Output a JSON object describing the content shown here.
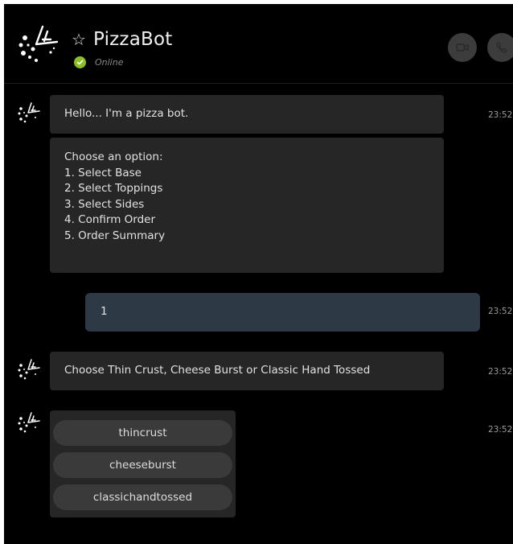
{
  "header": {
    "bot_name": "PizzaBot",
    "status": "Online",
    "favorite_icon": "star-outline-icon",
    "status_icon": "check-circle-icon",
    "video_icon": "video-camera-icon",
    "call_icon": "phone-icon",
    "status_color": "#8cbf26"
  },
  "messages": [
    {
      "sender": "bot",
      "text": "Hello... I'm a pizza bot.",
      "time": "23:52"
    },
    {
      "sender": "bot",
      "title": "Choose an option:",
      "options": [
        "1. Select Base",
        "2. Select Toppings",
        "3. Select Sides",
        "4. Confirm Order",
        "5. Order Summary"
      ]
    },
    {
      "sender": "user",
      "text": "1",
      "time": "23:52"
    },
    {
      "sender": "bot",
      "text": "Choose Thin Crust, Cheese Burst or Classic Hand Tossed",
      "time": "23:52"
    },
    {
      "sender": "bot",
      "choices": [
        "thincrust",
        "cheeseburst",
        "classichandtossed"
      ],
      "time": "23:52"
    }
  ],
  "colors": {
    "background": "#000000",
    "bot_bubble": "#262626",
    "user_bubble": "#2e3946",
    "choice_button": "#3a3a3a"
  }
}
